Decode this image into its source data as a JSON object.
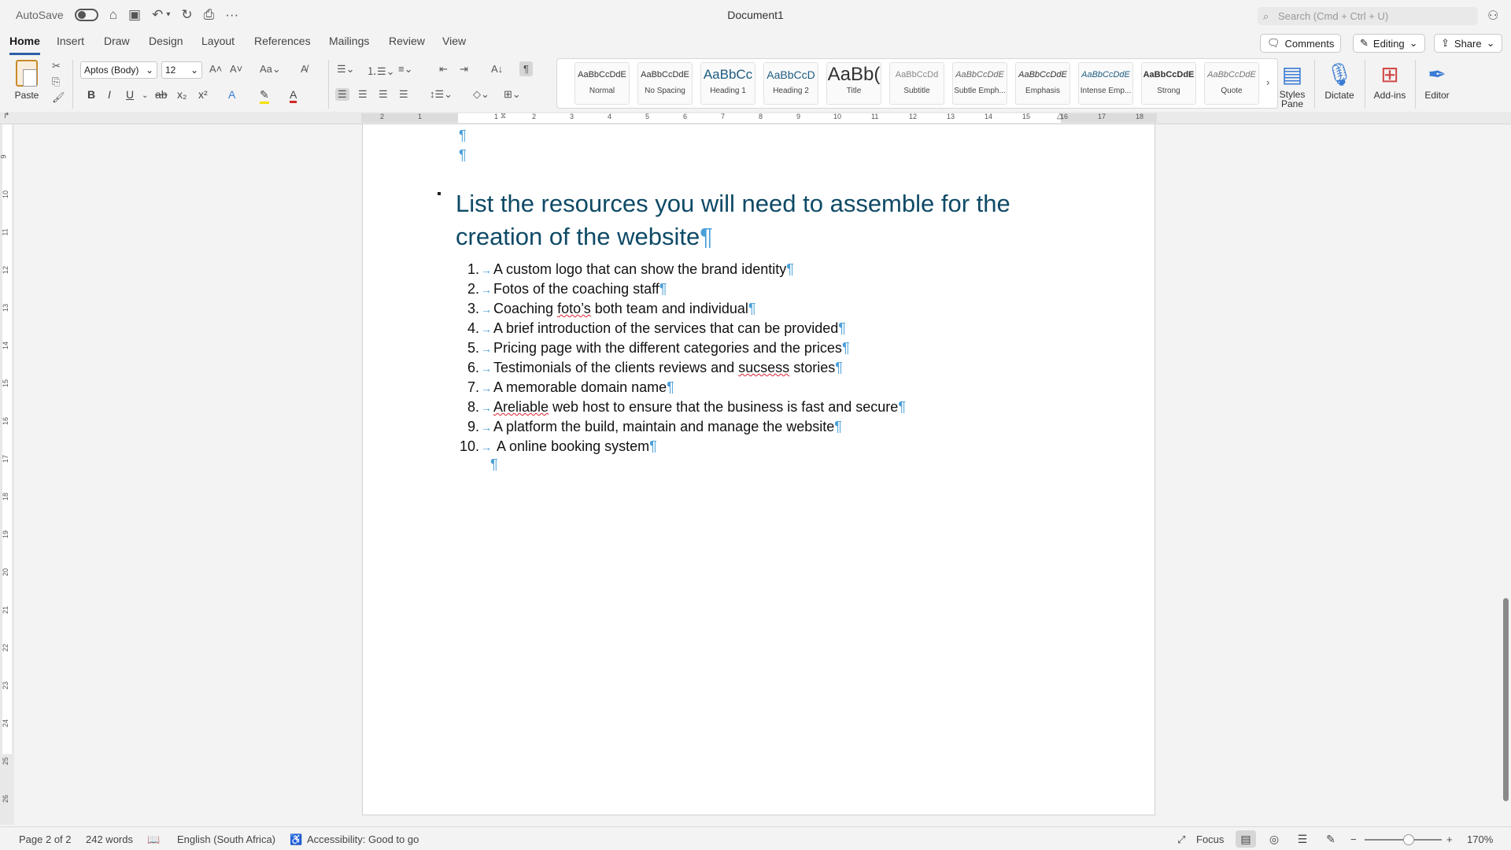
{
  "titlebar": {
    "autosave": "AutoSave",
    "doc_title": "Document1",
    "search_placeholder": "Search (Cmd + Ctrl + U)"
  },
  "tabs": [
    "Home",
    "Insert",
    "Draw",
    "Design",
    "Layout",
    "References",
    "Mailings",
    "Review",
    "View"
  ],
  "ribbon_buttons": {
    "comments": "Comments",
    "editing": "Editing",
    "share": "Share"
  },
  "ribbon": {
    "paste": "Paste",
    "font": "Aptos (Body)",
    "size": "12",
    "styles_pane": [
      "Styles",
      "Pane"
    ],
    "dictate": "Dictate",
    "addins": "Add-ins",
    "editor": "Editor",
    "styles": [
      {
        "preview": "AaBbCcDdE",
        "name": "Normal"
      },
      {
        "preview": "AaBbCcDdE",
        "name": "No Spacing"
      },
      {
        "preview": "AaBbCc",
        "name": "Heading 1"
      },
      {
        "preview": "AaBbCcD",
        "name": "Heading 2"
      },
      {
        "preview": "AaBb(",
        "name": "Title"
      },
      {
        "preview": "AaBbCcDd",
        "name": "Subtitle"
      },
      {
        "preview": "AaBbCcDdE",
        "name": "Subtle Emph..."
      },
      {
        "preview": "AaBbCcDdE",
        "name": "Emphasis"
      },
      {
        "preview": "AaBbCcDdE",
        "name": "Intense Emp..."
      },
      {
        "preview": "AaBbCcDdE",
        "name": "Strong"
      },
      {
        "preview": "AaBbCcDdE",
        "name": "Quote"
      }
    ]
  },
  "ruler": {
    "h_numbers": [
      "2",
      "1",
      "1",
      "2",
      "3",
      "4",
      "5",
      "6",
      "7",
      "8",
      "9",
      "10",
      "11",
      "12",
      "13",
      "14",
      "15",
      "16",
      "17",
      "18"
    ],
    "v_numbers": [
      "9",
      "10",
      "11",
      "12",
      "13",
      "14",
      "15",
      "16",
      "17",
      "18",
      "19",
      "20",
      "21",
      "22",
      "23",
      "24",
      "25",
      "26"
    ]
  },
  "document": {
    "heading_line1": "List the resources you will need to assemble for the",
    "heading_line2": "creation of the website",
    "items": [
      {
        "num": "1.",
        "text": "A custom logo that can show the brand identity"
      },
      {
        "num": "2.",
        "text": "Fotos of the coaching staff"
      },
      {
        "num": "3.",
        "pre": "Coaching ",
        "err": "foto’s",
        "post": " both team and individual"
      },
      {
        "num": "4.",
        "text": "A brief introduction of the services that can be provided"
      },
      {
        "num": "5.",
        "text": "Pricing page with the different categories and the prices"
      },
      {
        "num": "6.",
        "pre": "Testimonials of the clients reviews and ",
        "err": "sucsess",
        "post": " stories"
      },
      {
        "num": "7.",
        "text": "A memorable domain name"
      },
      {
        "num": "8.",
        "pre": "",
        "err": "Areliable",
        "post": " web host to ensure that the business is fast and secure"
      },
      {
        "num": "9.",
        "text": "A platform the build, maintain and manage the website"
      },
      {
        "num": "10.",
        "text": " A online booking system"
      }
    ]
  },
  "statusbar": {
    "page": "Page 2 of 2",
    "words": "242 words",
    "language": "English (South Africa)",
    "accessibility": "Accessibility: Good to go",
    "focus": "Focus",
    "zoom": "170%"
  }
}
